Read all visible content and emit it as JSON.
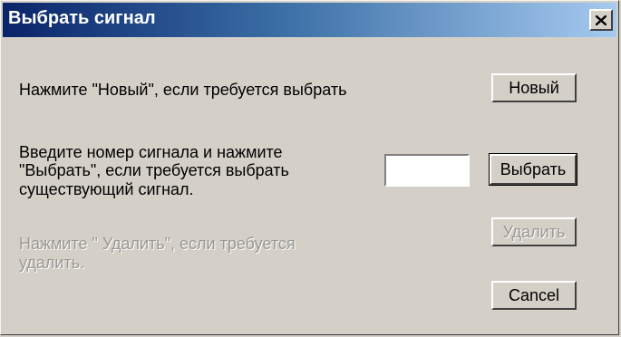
{
  "dialog": {
    "title": "Выбрать сигнал",
    "close_icon": "close-icon"
  },
  "new_section": {
    "instruction": "Нажмите \"Новый\", если требуется выбрать",
    "button_label": "Новый"
  },
  "select_section": {
    "instruction_lines": [
      "Введите номер сигнала и нажмите",
      "\"Выбрать\", если требуется выбрать",
      "существующий сигнал."
    ],
    "signal_number_value": "",
    "button_label": "Выбрать"
  },
  "delete_section": {
    "instruction_lines": [
      "Нажмите \" Удалить\", если требуется",
      "удалить."
    ],
    "button_label": "Удалить",
    "disabled": true
  },
  "cancel_button_label": "Cancel",
  "colors": {
    "titlebar_start": "#0a246a",
    "titlebar_end": "#a6caf0",
    "face": "#d4d0c8",
    "disabled_text": "#9a9892"
  }
}
